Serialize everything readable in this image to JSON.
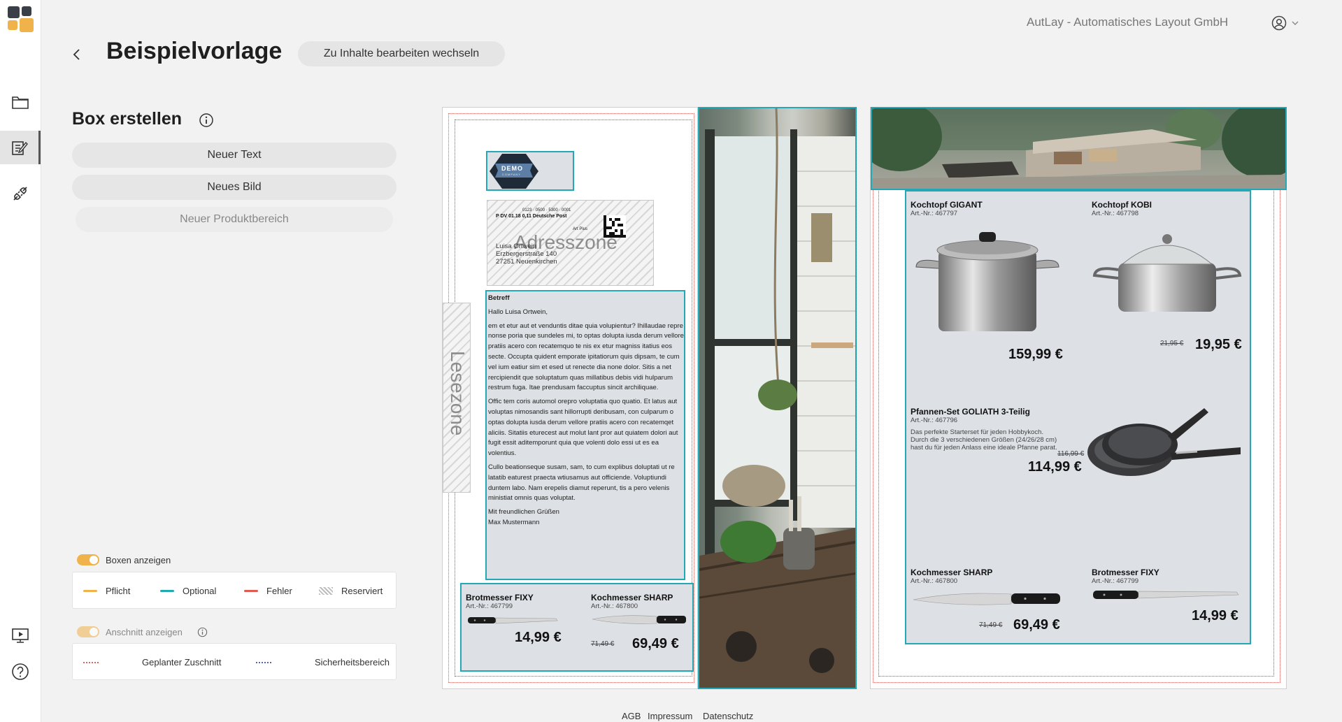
{
  "header": {
    "company": "AutLay - Automatisches Layout GmbH",
    "title": "Beispielvorlage",
    "switch_button": "Zu Inhalte bearbeiten wechseln"
  },
  "sidebar": {
    "icons": [
      "folder-icon",
      "edit-template-icon",
      "connect-icon",
      "presentation-icon",
      "help-icon"
    ]
  },
  "panel": {
    "title": "Box erstellen",
    "buttons": {
      "new_text": "Neuer Text",
      "new_image": "Neues Bild",
      "new_product_area": "Neuer Produktbereich"
    },
    "show_boxes": "Boxen anzeigen",
    "box_legend": [
      {
        "label": "Pflicht",
        "color": "#f0b24a"
      },
      {
        "label": "Optional",
        "color": "#23a8b5"
      },
      {
        "label": "Fehler",
        "color": "#e05a52"
      },
      {
        "label": "Reserviert",
        "color": "#bdbdbd"
      }
    ],
    "show_bleed": "Anschnitt anzeigen",
    "bleed_legend": [
      {
        "label": "Geplanter Zuschnitt",
        "color": "#d9645f"
      },
      {
        "label": "Sicherheitsbereich",
        "color": "#5466a8"
      }
    ]
  },
  "footer": {
    "links": [
      "AGB",
      "Impressum",
      "Datenschutz"
    ]
  },
  "page1": {
    "logo_text": "DEMO",
    "logo_sub": "COMPANY",
    "address_zone": "Adresszone",
    "address_lines": [
      "Luisa Ortwein",
      "Erzbergerstraße 140",
      "27251 Neuenkirchen"
    ],
    "postage_line1": "P  DV 01.18  0,11 Deutsche Post",
    "postage_line2": "Art Plus",
    "postage_top": "0123 · 0500 · 5300 · 0001",
    "read_zone": "Lesezone",
    "letter": {
      "subject": "Betreff",
      "greeting": "Hallo Luisa Ortwein,",
      "para1": "em et etur aut et venduntis ditae quia volupientur? Ihillaudae repre nonse poria que sundeles mi, to optas dolupta iusda derum vellore pratiis acero con recatemquo te nis ex etur magniss itatius eos secte. Occupta quident emporate ipitatiorum quis dipsam, te cum vel ium eatiur sim et esed ut renecte dia none dolor. Sitis a net rercipiendit que soluptatum quas millatibus debis vidi hulparum restrum fuga. Itae prendusam faccuptus sincit archiliquae.",
      "para2": "Offic tem coris automol orepro voluptatia quo quatio. Et latus aut voluptas nimosandis sant hillorrupti deribusam, con culparum o optas dolupta iusda derum vellore pratiis acero con recatemqet aliciis. Sitatiis eturecest aut molut lant pror aut quiatem dolori aut fugit essit aditemporunt quia que volenti dolo essi ut es ea volentius.",
      "para3": "Cullo beationseque susam, sam, to cum explibus doluptati ut re latatib eaturest praecta wtiusamus aut officiende. Voluptiundi duntem labo. Nam erepelis diamut reperunt, tis a pero velenis ministiat omnis quas voluptat.",
      "closing": "Mit freundlichen Grüßen",
      "signature": "Max Mustermann"
    },
    "products": [
      {
        "name": "Brotmesser FIXY",
        "art": "Art.-Nr.: 467799",
        "price": "14,99 €",
        "old": ""
      },
      {
        "name": "Kochmesser SHARP",
        "art": "Art.-Nr.: 467800",
        "price": "69,49 €",
        "old": "71,49 €"
      }
    ]
  },
  "page2": {
    "products": [
      {
        "name": "Kochtopf GIGANT",
        "art": "Art.-Nr.: 467797",
        "price": "159,99 €",
        "old": ""
      },
      {
        "name": "Kochtopf KOBI",
        "art": "Art.-Nr.: 467798",
        "price": "19,95 €",
        "old": "21,95 €"
      },
      {
        "name": "Pfannen-Set GOLIATH 3-Teilig",
        "art": "Art.-Nr.: 467796",
        "desc1": "Das perfekte Starterset für jeden Hobbykoch.",
        "desc2": "Durch die 3 verschiedenen Größen (24/26/28 cm)",
        "desc3": "hast du für jeden Anlass eine ideale Pfanne parat.",
        "price": "114,99 €",
        "old": "116,99 €"
      },
      {
        "name": "Kochmesser SHARP",
        "art": "Art.-Nr.: 467800",
        "price": "69,49 €",
        "old": "71,49 €"
      },
      {
        "name": "Brotmesser FIXY",
        "art": "Art.-Nr.: 467799",
        "price": "14,99 €",
        "old": ""
      }
    ]
  }
}
